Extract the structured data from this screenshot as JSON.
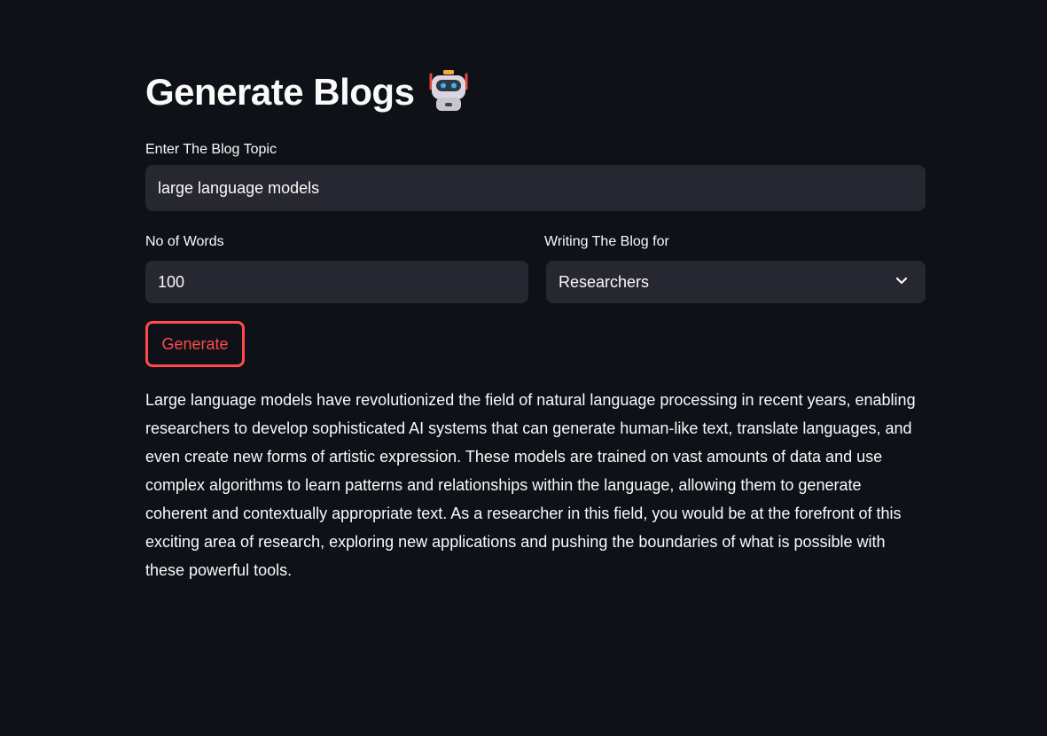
{
  "header": {
    "title": "Generate Blogs",
    "title_icon": "robot-icon"
  },
  "form": {
    "topic_label": "Enter The Blog Topic",
    "topic_value": "large language models",
    "words_label": "No of Words",
    "words_value": "100",
    "audience_label": "Writing The Blog for",
    "audience_value": "Researchers",
    "generate_label": "Generate"
  },
  "output": {
    "text": "Large language models have revolutionized the field of natural language processing in recent years, enabling researchers to develop sophisticated AI systems that can generate human-like text, translate languages, and even create new forms of artistic expression. These models are trained on vast amounts of data and use complex algorithms to learn patterns and relationships within the language, allowing them to generate coherent and contextually appropriate text. As a researcher in this field, you would be at the forefront of this exciting area of research, exploring new applications and pushing the boundaries of what is possible with these powerful tools."
  },
  "colors": {
    "background": "#0e1117",
    "input_bg": "#262730",
    "accent": "#ff4b4b",
    "text": "#fafafa"
  }
}
